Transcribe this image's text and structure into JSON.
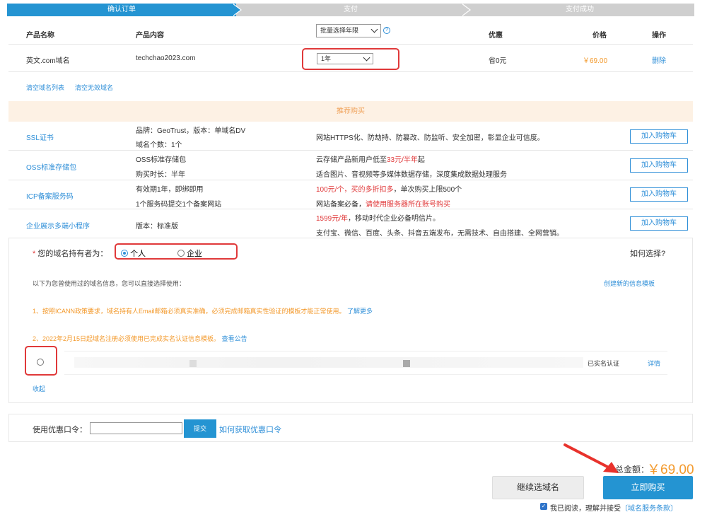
{
  "steps": [
    "确认订单",
    "支付",
    "支付成功"
  ],
  "table": {
    "headers": {
      "name": "产品名称",
      "content": "产品内容",
      "batch_select": "批量选择年限",
      "discount": "优惠",
      "price": "价格",
      "action": "操作"
    },
    "row": {
      "name": "英文.com域名",
      "content": "techchao2023.com",
      "years": "1年",
      "discount": "省0元",
      "price": "￥69.00",
      "delete": "删除"
    }
  },
  "links": {
    "clear_list": "清空域名列表",
    "clear_invalid": "清空无效域名"
  },
  "recommend": {
    "title": "推荐购买",
    "cart_label": "加入购物车",
    "items": [
      {
        "name": "SSL证书",
        "spec1": "品牌：GeoTrust，版本：单域名DV",
        "spec2": "域名个数：1个",
        "desc1": "网站HTTPS化、防劫持、防篡改、防监听、安全加密，彰显企业可信度。",
        "desc2": ""
      },
      {
        "name": "OSS标准存储包",
        "spec1": "OSS标准存储包",
        "spec2": "购买时长：半年",
        "desc1_a": "云存储产品新用户低至",
        "desc1_red": "33元/半年",
        "desc1_b": "起",
        "desc2": "适合图片、音视频等多媒体数据存储，深度集成数据处理服务"
      },
      {
        "name": "ICP备案服务码",
        "spec1": "有效期1年，即绑即用",
        "spec2": "1个服务码提交1个备案网站",
        "desc1_red": "100元/个，买的多折扣多",
        "desc1_b": "，单次购买上限500个",
        "desc2_a": "网站备案必备，",
        "desc2_red": "请使用服务器所在账号购买"
      },
      {
        "name": "企业展示多端小程序",
        "spec1": "版本：标准版",
        "desc1_red": "1599元/年",
        "desc1_b": "，移动时代企业必备明信片。",
        "desc2": "支付宝、微信、百度、头条、抖音五端发布，无需技术、自由搭建、全网营销。"
      }
    ]
  },
  "owner": {
    "required_mark": "*",
    "label": "您的域名持有者为：",
    "option_personal": "个人",
    "option_company": "企业",
    "how_to_choose": "如何选择?",
    "info_text": "以下为您曾使用过的域名信息，您可以直接选择使用：",
    "create_template": "创建新的信息模板",
    "notice1": "1、按照ICANN政策要求，域名持有人Email邮箱必须真实准确，必须完成邮箱真实性验证的模板才能正常使用。",
    "notice1_link": "了解更多",
    "notice2": "2、2022年2月15日起域名注册必须使用已完成实名认证信息模板。",
    "notice2_link": "查看公告",
    "template_status": "已实名认证",
    "template_detail": "详情",
    "collapse": "收起"
  },
  "coupon": {
    "label": "使用优惠口令：",
    "submit": "提交",
    "how_to_get": "如何获取优惠口令"
  },
  "total": {
    "label": "总金额：",
    "amount": "￥69.00"
  },
  "buttons": {
    "continue": "继续选域名",
    "buy_now": "立即购买"
  },
  "agreement": {
    "text": "我已阅读，理解并接受",
    "link": "〔域名服务条款〕"
  },
  "colors": {
    "primary": "#2494d2",
    "link": "#2f8fd8",
    "highlight_box": "#e0393a",
    "price": "#f39a2d"
  }
}
